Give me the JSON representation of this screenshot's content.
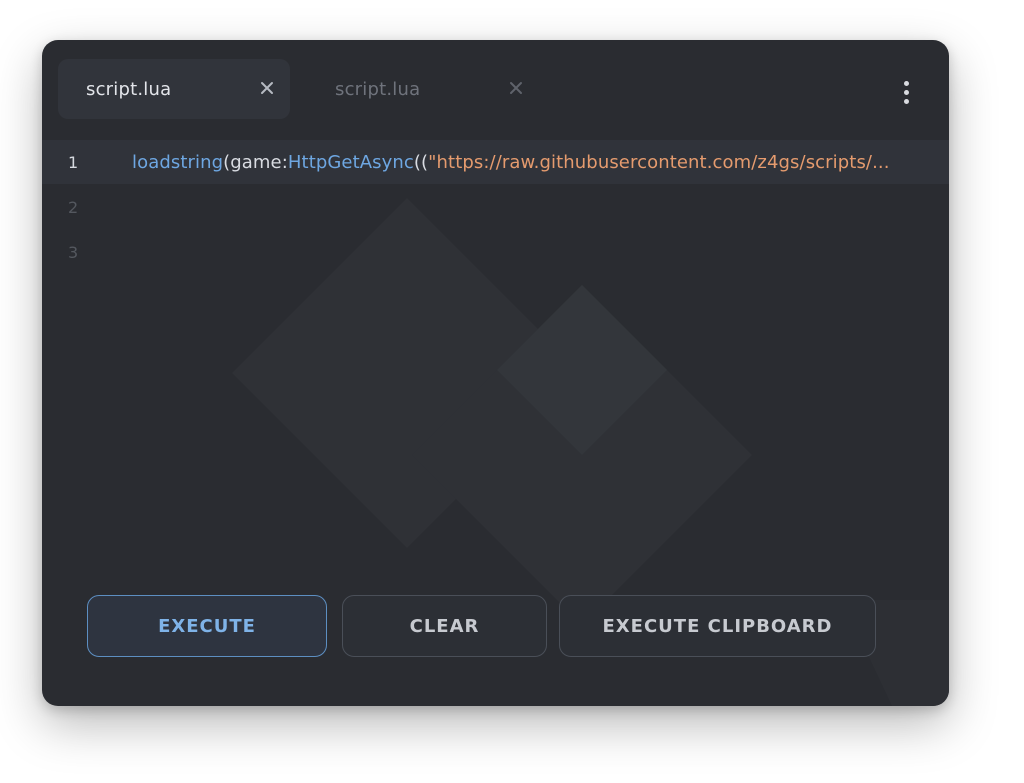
{
  "tabs": [
    {
      "label": "script.lua",
      "active": true
    },
    {
      "label": "script.lua",
      "active": false
    }
  ],
  "menu_icon": "more-vertical-icon",
  "editor": {
    "lines": [
      {
        "number": "1",
        "tokens": [
          {
            "text": "loadstring",
            "kind": "fn"
          },
          {
            "text": "(game:",
            "kind": "plain"
          },
          {
            "text": "HttpGetAsync",
            "kind": "fn"
          },
          {
            "text": "((",
            "kind": "plain"
          },
          {
            "text": "\"https://raw.githubusercontent.com/z4gs/scripts/...",
            "kind": "str"
          }
        ]
      },
      {
        "number": "2",
        "tokens": []
      },
      {
        "number": "3",
        "tokens": []
      }
    ]
  },
  "buttons": {
    "execute": "EXECUTE",
    "clear": "CLEAR",
    "execute_clipboard": "EXECUTE CLIPBOARD"
  },
  "colors": {
    "accent": "#6ea7e2",
    "string": "#e59b6e",
    "background": "#2a2c31"
  }
}
